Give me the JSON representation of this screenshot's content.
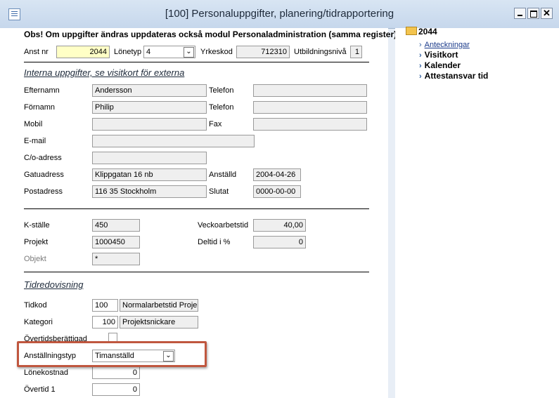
{
  "window": {
    "title": "[100]  Personaluppgifter, planering/tidrapportering"
  },
  "notice": "Obs! Om uppgifter ändras uppdateras också modul Personaladministration (samma register)",
  "header_row": {
    "anst_nr_label": "Anst nr",
    "anst_nr_value": "2044",
    "lonetyp_label": "Lönetyp",
    "lonetyp_value": "4",
    "yrkeskod_label": "Yrkeskod",
    "yrkeskod_value": "712310",
    "utbildningsniva_label": "Utbildningsnivå",
    "utbildningsniva_value": "1"
  },
  "section_internal": "Interna uppgifter, se visitkort för externa",
  "internal": {
    "efternamn_label": "Efternamn",
    "efternamn_value": "Andersson",
    "fornamn_label": "Förnamn",
    "fornamn_value": "Philip",
    "mobil_label": "Mobil",
    "mobil_value": "",
    "email_label": "E-mail",
    "email_value": "",
    "co_label": "C/o-adress",
    "co_value": "",
    "gatuadress_label": "Gatuadress",
    "gatuadress_value": "Klippgatan 16 nb",
    "postadress_label": "Postadress",
    "postadress_value": "116 35  Stockholm",
    "telefon1_label": "Telefon",
    "telefon1_value": "",
    "telefon2_label": "Telefon",
    "telefon2_value": "",
    "fax_label": "Fax",
    "fax_value": "",
    "anstalld_label": "Anställd",
    "anstalld_value": "2004-04-26",
    "slutat_label": "Slutat",
    "slutat_value": "0000-00-00"
  },
  "cost": {
    "kstalle_label": "K-ställe",
    "kstalle_value": "450",
    "projekt_label": "Projekt",
    "projekt_value": "1000450",
    "objekt_label": "Objekt",
    "objekt_value": "*",
    "veckoarbetstid_label": "Veckoarbetstid",
    "veckoarbetstid_value": "40,00",
    "deltid_label": "Deltid i %",
    "deltid_value": "0"
  },
  "section_time": "Tidredovisning",
  "time": {
    "tidkod_label": "Tidkod",
    "tidkod_value": "100",
    "tidkod_desc": "Normalarbetstid Projekts",
    "kategori_label": "Kategori",
    "kategori_value": "100",
    "kategori_desc": "Projektsnickare",
    "overtid_label": "Övertidsberättigad",
    "anstallningstyp_label": "Anställningstyp",
    "anstallningstyp_value": "Timanställd",
    "lonekostnad_label": "Lönekostnad",
    "lonekostnad_value": "0",
    "overtid1_label": "Övertid 1",
    "overtid1_value": "0"
  },
  "tree": {
    "root": "2044",
    "items": [
      {
        "label": "Anteckningar"
      },
      {
        "label": "Visitkort"
      },
      {
        "label": "Kalender"
      },
      {
        "label": "Attestansvar tid"
      }
    ]
  },
  "colors": {
    "highlight": "#c0573f",
    "yellow_field": "#ffffc6"
  }
}
